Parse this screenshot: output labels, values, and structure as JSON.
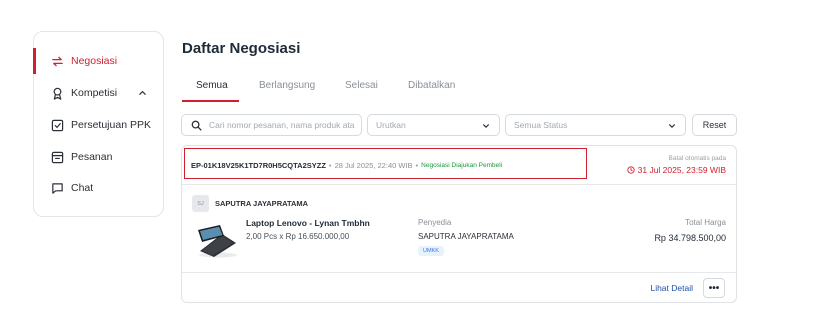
{
  "sidebar": {
    "items": [
      {
        "label": "Negosiasi",
        "icon": "swap-arrows-icon"
      },
      {
        "label": "Kompetisi",
        "icon": "award-icon"
      },
      {
        "label": "Persetujuan PPK",
        "icon": "checkbox-icon"
      },
      {
        "label": "Pesanan",
        "icon": "inbox-icon"
      },
      {
        "label": "Chat",
        "icon": "chat-icon"
      }
    ]
  },
  "page": {
    "title": "Daftar Negosiasi"
  },
  "tabs": [
    {
      "label": "Semua"
    },
    {
      "label": "Berlangsung"
    },
    {
      "label": "Selesai"
    },
    {
      "label": "Dibatalkan"
    }
  ],
  "filters": {
    "search_placeholder": "Cari nomor pesanan, nama produk ata",
    "sort_placeholder": "Urutkan",
    "status_placeholder": "Semua Status",
    "reset_label": "Reset"
  },
  "order": {
    "id": "EP-01K18V25K1TD7R0H5CQTA2SYZZ",
    "date": "28 Jul 2025, 22:40 WIB",
    "status": "Negosiasi Diajukan Pembeli",
    "auto_cancel_label": "Batal otomatis pada",
    "auto_cancel_date": "31 Jul 2025, 23:59 WIB",
    "seller_initials": "SJ",
    "seller": "SAPUTRA JAYAPRATAMA",
    "product_name": "Laptop Lenovo - Lynan Tmbhn",
    "product_qty": "2,00 Pcs x Rp 16.650.000,00",
    "provider_label": "Penyedia",
    "provider_name": "SAPUTRA JAYAPRATAMA",
    "provider_badge": "UMKK",
    "total_label": "Total Harga",
    "total_value": "Rp 34.798.500,00",
    "detail_label": "Lihat Detail",
    "more_label": "•••"
  },
  "colors": {
    "accent": "#d0202f",
    "link": "#1f4fa8",
    "success": "#1a9a3a"
  }
}
